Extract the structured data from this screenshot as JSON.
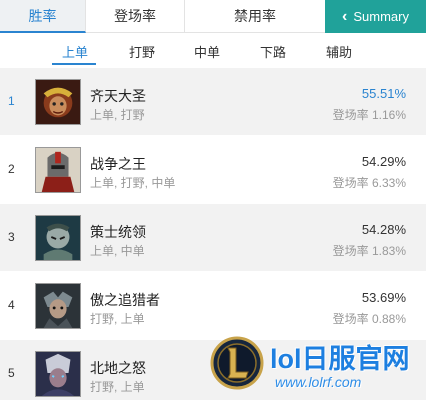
{
  "tabs": [
    {
      "label": "胜率"
    },
    {
      "label": "登场率"
    },
    {
      "label": "禁用率"
    }
  ],
  "summary_button": {
    "label": "Summary"
  },
  "subtabs": [
    {
      "label": "上单"
    },
    {
      "label": "打野"
    },
    {
      "label": "中单"
    },
    {
      "label": "下路"
    },
    {
      "label": "辅助"
    }
  ],
  "rows": [
    {
      "rank": "1",
      "name": "齐天大圣",
      "roles": "上单, 打野",
      "winrate": "55.51%",
      "pickrate": "登场率 1.16%"
    },
    {
      "rank": "2",
      "name": "战争之王",
      "roles": "上单, 打野, 中单",
      "winrate": "54.29%",
      "pickrate": "登场率 6.33%"
    },
    {
      "rank": "3",
      "name": "策士统领",
      "roles": "上单, 中单",
      "winrate": "54.28%",
      "pickrate": "登场率 1.83%"
    },
    {
      "rank": "4",
      "name": "傲之追猎者",
      "roles": "打野, 上单",
      "winrate": "53.69%",
      "pickrate": "登场率 0.88%"
    },
    {
      "rank": "5",
      "name": "北地之怒",
      "roles": "打野, 上单",
      "winrate": "",
      "pickrate": ""
    }
  ],
  "watermark": {
    "title": "lol日服官网",
    "url": "www.lolrf.com"
  },
  "colors": {
    "accent": "#2a84d0",
    "summary_bg": "#20a29a",
    "row_alt": "#f2f2f2"
  }
}
